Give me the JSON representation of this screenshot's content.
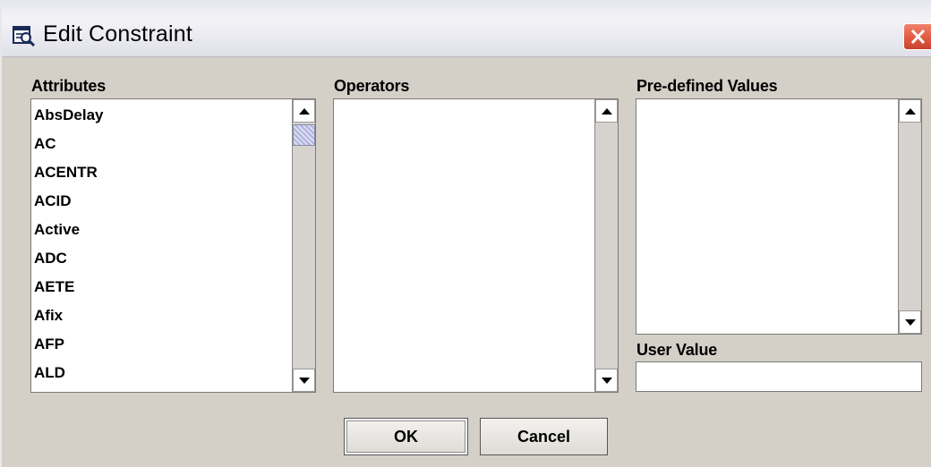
{
  "window": {
    "title": "Edit Constraint",
    "icon": "search-icon"
  },
  "attributes": {
    "label": "Attributes",
    "items": [
      "AbsDelay",
      "AC",
      "ACENTR",
      "ACID",
      "Active",
      "ADC",
      "AETE",
      "Afix",
      "AFP",
      "ALD"
    ]
  },
  "operators": {
    "label": "Operators",
    "items": []
  },
  "predefined": {
    "label": "Pre-defined Values",
    "items": []
  },
  "user_value": {
    "label": "User Value",
    "value": "",
    "placeholder": ""
  },
  "buttons": {
    "ok": "OK",
    "cancel": "Cancel"
  },
  "colors": {
    "close_button": "#e25a42",
    "scroll_thumb": "#c9cbe6",
    "dialog_background": "#d4d0c8"
  }
}
